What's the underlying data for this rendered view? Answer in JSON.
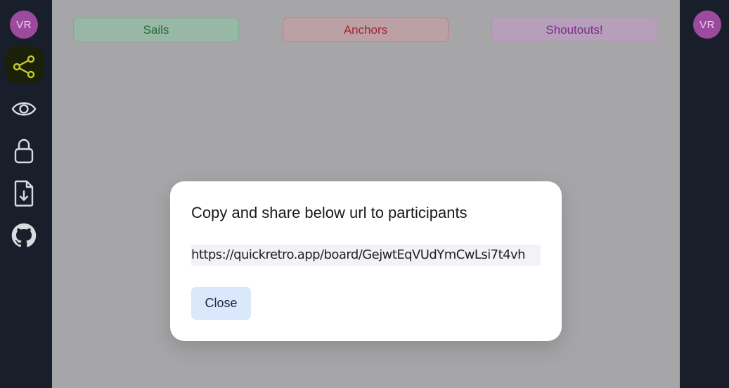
{
  "sidebar": {
    "avatar_initials": "VR",
    "icons": [
      "share-icon",
      "eye-icon",
      "lock-icon",
      "file-download-icon",
      "github-icon"
    ]
  },
  "right_sidebar": {
    "avatar_initials": "VR"
  },
  "board": {
    "columns": [
      {
        "label": "Sails",
        "color": "#1f6b3c"
      },
      {
        "label": "Anchors",
        "color": "#a2232b"
      },
      {
        "label": "Shoutouts!",
        "color": "#7e2a8c"
      }
    ]
  },
  "modal": {
    "title": "Copy and share below url to participants",
    "url": "https://quickretro.app/board/GejwtEqVUdYmCwLsi7t4vh",
    "close_label": "Close"
  },
  "colors": {
    "sidebar_bg": "#181f2b",
    "avatar_bg": "#9b4a9d",
    "share_icon_accent": "#c9c92a",
    "overlay": "#a6a6a9"
  }
}
